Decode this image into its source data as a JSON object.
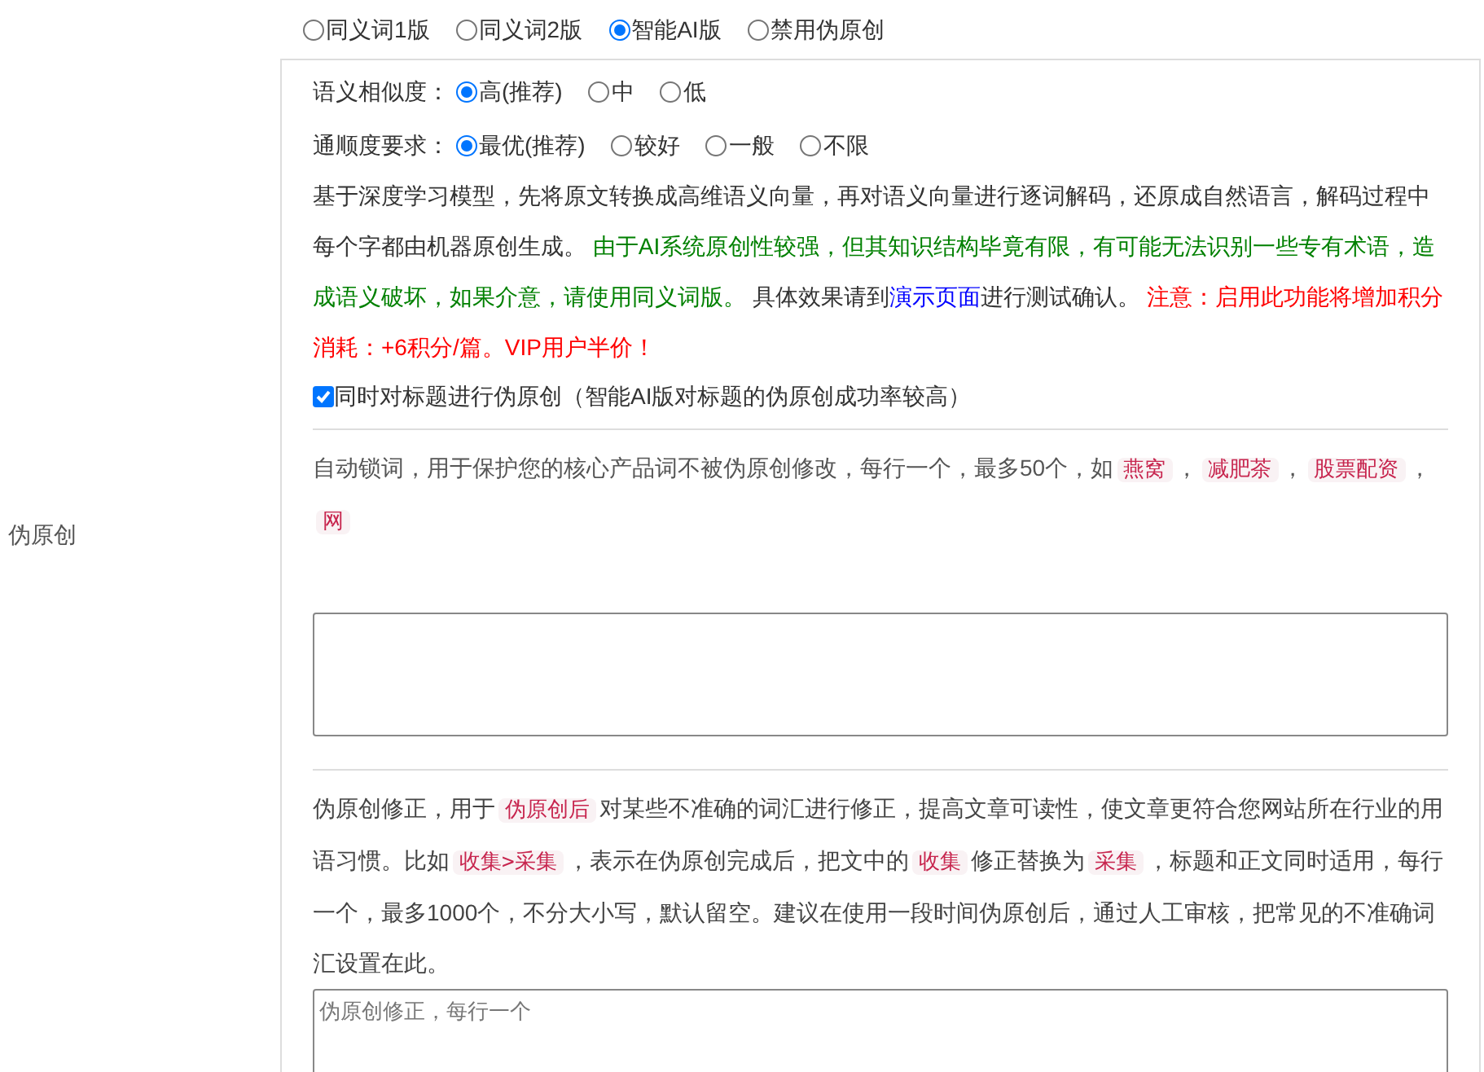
{
  "mode_options": [
    {
      "label": "同义词1版",
      "selected": false
    },
    {
      "label": "同义词2版",
      "selected": false
    },
    {
      "label": "智能AI版",
      "selected": true
    },
    {
      "label": "禁用伪原创",
      "selected": false
    }
  ],
  "ai_settings": {
    "similarity": {
      "label": "语义相似度：",
      "options": [
        {
          "label": "高(推荐)",
          "selected": true
        },
        {
          "label": "中",
          "selected": false
        },
        {
          "label": "低",
          "selected": false
        }
      ]
    },
    "fluency": {
      "label": "通顺度要求：",
      "options": [
        {
          "label": "最优(推荐)",
          "selected": true
        },
        {
          "label": "较好",
          "selected": false
        },
        {
          "label": "一般",
          "selected": false
        },
        {
          "label": "不限",
          "selected": false
        }
      ]
    },
    "description": [
      {
        "kind": "text",
        "text": "基于深度学习模型，先将原文转换成高维语义向量，再对语义向量进行逐词解码，还原成自然语言，解码过程中每个字都由机器原创生成。 "
      },
      {
        "kind": "success",
        "text": "由于AI系统原创性较强，但其知识结构毕竟有限，有可能无法识别一些专有术语，造成语义破坏，如果介意，请使用同义词版。"
      },
      {
        "kind": "text",
        "text": " 具体效果请到"
      },
      {
        "kind": "link",
        "text": "演示页面"
      },
      {
        "kind": "text",
        "text": "进行测试确认。 "
      },
      {
        "kind": "warning",
        "text": "注意：启用此功能将增加积分消耗：+6积分/篇。VIP用户半价！"
      }
    ],
    "title_option": {
      "label": "同时对标题进行伪原创（智能AI版对标题的伪原创成功率较高）",
      "checked": true
    }
  },
  "lock_words": {
    "label": "伪原创",
    "description": [
      {
        "kind": "text",
        "text": "自动锁词，用于保护您的核心产品词不被伪原创修改，每行一个，最多50个，如"
      },
      {
        "kind": "code",
        "text": "燕窝"
      },
      {
        "kind": "text",
        "text": "，"
      },
      {
        "kind": "code",
        "text": "减肥茶"
      },
      {
        "kind": "text",
        "text": "，"
      },
      {
        "kind": "code",
        "text": "股票配资"
      },
      {
        "kind": "text",
        "text": "，"
      },
      {
        "kind": "code",
        "text": "网"
      }
    ]
  },
  "correction": {
    "description": [
      {
        "kind": "text",
        "text": "伪原创修正，用于"
      },
      {
        "kind": "code",
        "text": "伪原创后"
      },
      {
        "kind": "text",
        "text": "对某些不准确的词汇进行修正，提高文章可读性，使文章更符合您网站所在行业的用语习惯。比如"
      },
      {
        "kind": "code",
        "text": "收集>采集"
      },
      {
        "kind": "text",
        "text": "，表示在伪原创完成后，把文中的"
      },
      {
        "kind": "code",
        "text": "收集"
      },
      {
        "kind": "text",
        "text": "修正替换为"
      },
      {
        "kind": "code",
        "text": "采集"
      },
      {
        "kind": "text",
        "text": "，标题和正文同时适用，每行一个，最多1000个，不分大小写，默认留空。建议在使用一段时间伪原创后，通过人工审核，把常见的不准确词汇设置在此。"
      }
    ],
    "placeholder": "伪原创修正，每行一个"
  }
}
